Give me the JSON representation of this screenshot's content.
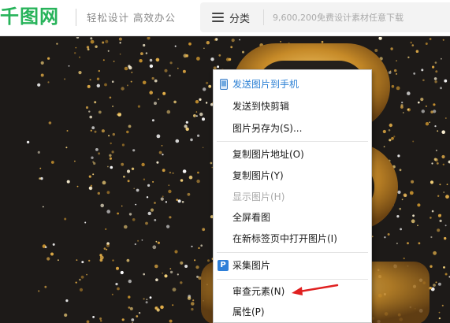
{
  "header": {
    "logo_text": "千图网",
    "slogan": "轻松设计  高效办公",
    "category_label": "分类",
    "search_placeholder": "9,600,200免费设计素材任意下载"
  },
  "context_menu": {
    "items": [
      {
        "label": "发送图片到手机",
        "icon": "phone-icon",
        "state": "highlighted"
      },
      {
        "label": "发送到快剪辑"
      },
      {
        "label": "图片另存为(S)..."
      },
      {
        "label": "复制图片地址(O)"
      },
      {
        "label": "复制图片(Y)"
      },
      {
        "label": "显示图片(H)",
        "state": "disabled"
      },
      {
        "label": "全屏看图"
      },
      {
        "label": "在新标签页中打开图片(I)"
      },
      {
        "label": "采集图片",
        "icon": "p-icon",
        "icon_text": "P"
      },
      {
        "label": "审查元素(N)"
      },
      {
        "label": "属性(P)"
      }
    ]
  },
  "colors": {
    "brand_green": "#27b35a",
    "menu_highlight": "#2a7fd4",
    "arrow_red": "#e02020",
    "gold": "#c8922e"
  }
}
